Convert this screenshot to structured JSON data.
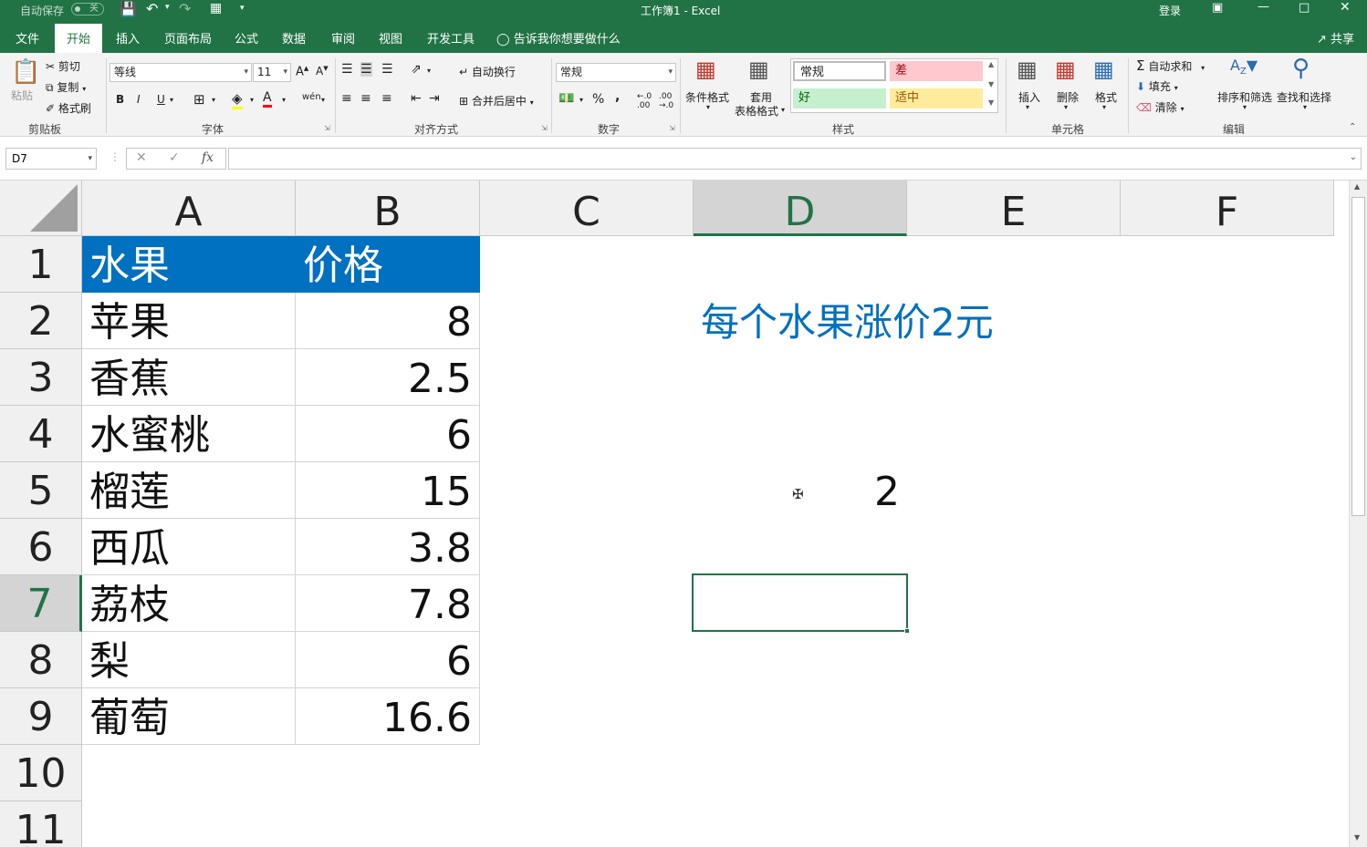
{
  "titlebar": {
    "autosave_label": "自动保存",
    "autosave_state": "关",
    "title": "工作簿1 - Excel",
    "login": "登录"
  },
  "tabs": [
    "文件",
    "开始",
    "插入",
    "页面布局",
    "公式",
    "数据",
    "审阅",
    "视图",
    "开发工具"
  ],
  "active_tab": "开始",
  "tell_me": "告诉我你想要做什么",
  "share": "共享",
  "ribbon": {
    "clipboard": {
      "paste": "粘贴",
      "cut": "剪切",
      "copy": "复制",
      "format_painter": "格式刷",
      "label": "剪贴板"
    },
    "font": {
      "name": "等线",
      "size": "11",
      "bold": "B",
      "italic": "I",
      "underline": "U",
      "label": "字体"
    },
    "alignment": {
      "wrap": "自动换行",
      "merge": "合并后居中",
      "label": "对齐方式"
    },
    "number": {
      "format": "常规",
      "label": "数字"
    },
    "styles": {
      "conditional": "条件格式",
      "table_line1": "套用",
      "table_line2": "表格格式",
      "cells": [
        {
          "text": "常规",
          "bg": "#ffffff",
          "fg": "#000000"
        },
        {
          "text": "差",
          "bg": "#ffc7ce",
          "fg": "#9c0006"
        },
        {
          "text": "好",
          "bg": "#c6efce",
          "fg": "#006100"
        },
        {
          "text": "适中",
          "bg": "#ffeb9c",
          "fg": "#9c5700"
        }
      ],
      "label": "样式"
    },
    "cells": {
      "insert": "插入",
      "delete": "删除",
      "format": "格式",
      "label": "单元格"
    },
    "editing": {
      "autosum": "自动求和",
      "fill": "填充",
      "clear": "清除",
      "sort": "排序和筛选",
      "find": "查找和选择",
      "label": "编辑"
    }
  },
  "formula_bar": {
    "name_box": "D7",
    "fx": "fx",
    "value": ""
  },
  "sheet": {
    "columns": [
      "A",
      "B",
      "C",
      "D",
      "E",
      "F"
    ],
    "active_column": "D",
    "rows": [
      "1",
      "2",
      "3",
      "4",
      "5",
      "6",
      "7",
      "8",
      "9",
      "10",
      "11"
    ],
    "active_row": "7",
    "table": [
      {
        "a": "水果",
        "b": "价格"
      },
      {
        "a": "苹果",
        "b": "8"
      },
      {
        "a": "香蕉",
        "b": "2.5"
      },
      {
        "a": "水蜜桃",
        "b": "6"
      },
      {
        "a": "榴莲",
        "b": "15"
      },
      {
        "a": "西瓜",
        "b": "3.8"
      },
      {
        "a": "荔枝",
        "b": "7.8"
      },
      {
        "a": "梨",
        "b": "6"
      },
      {
        "a": "葡萄",
        "b": "16.6"
      }
    ],
    "note": "每个水果涨价2元",
    "d5_value": "2",
    "colors": {
      "header_fill": "#0070c0",
      "note_color": "#0070c0",
      "accent": "#217346"
    }
  }
}
